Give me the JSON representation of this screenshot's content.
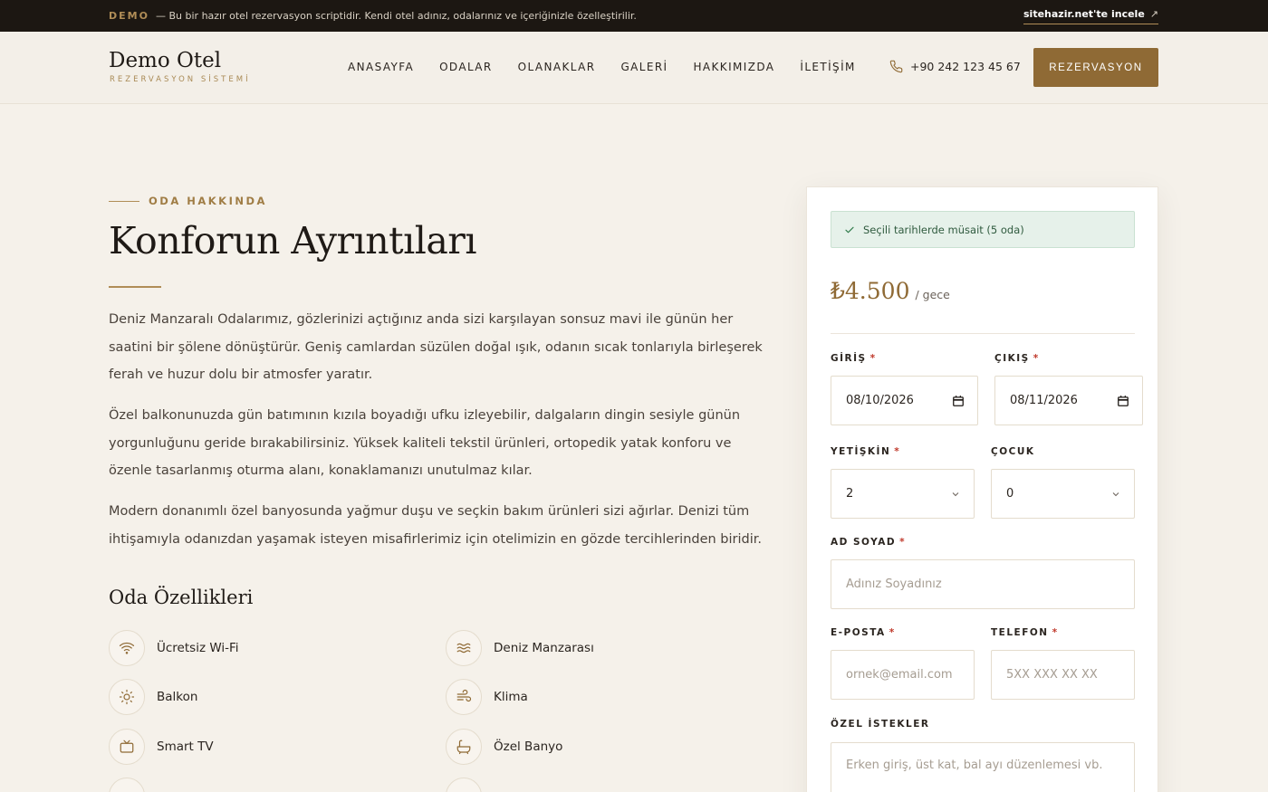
{
  "demo_bar": {
    "tag": "DEMO",
    "message": "— Bu bir hazır otel rezervasyon scriptidir. Kendi otel adınız, odalarınız ve içeriğinizle özelleştirilir.",
    "link_label": "sitehazir.net'te incele",
    "link_arrow": "↗"
  },
  "header": {
    "logo_title": "Demo Otel",
    "logo_subtitle": "REZERVASYON SİSTEMİ",
    "nav": [
      "ANASAYFA",
      "ODALAR",
      "OLANAKLAR",
      "GALERİ",
      "HAKKIMIZDA",
      "İLETİŞİM"
    ],
    "phone": "+90 242 123 45 67",
    "cta_label": "REZERVASYON"
  },
  "about": {
    "eyebrow": "ODA HAKKINDA",
    "title": "Konforun Ayrıntıları",
    "paragraphs": [
      "Deniz Manzaralı Odalarımız, gözlerinizi açtığınız anda sizi karşılayan sonsuz mavi ile günün her saatini bir şölene dönüştürür. Geniş camlardan süzülen doğal ışık, odanın sıcak tonlarıyla birleşerek ferah ve huzur dolu bir atmosfer yaratır.",
      "Özel balkonunuzda gün batımının kızıla boyadığı ufku izleyebilir, dalgaların dingin sesiyle günün yorgunluğunu geride bırakabilirsiniz. Yüksek kaliteli tekstil ürünleri, ortopedik yatak konforu ve özenle tasarlanmış oturma alanı, konaklamanızı unutulmaz kılar.",
      "Modern donanımlı özel banyosunda yağmur duşu ve seçkin bakım ürünleri sizi ağırlar. Denizi tüm ihtişamıyla odanızdan yaşamak isteyen misafirlerimiz için otelimizin en gözde tercihlerinden biridir."
    ],
    "features_title": "Oda Özellikleri",
    "features": [
      {
        "label": "Ücretsiz Wi-Fi",
        "icon": "wifi-icon"
      },
      {
        "label": "Deniz Manzarası",
        "icon": "waves-icon"
      },
      {
        "label": "Balkon",
        "icon": "sun-icon"
      },
      {
        "label": "Klima",
        "icon": "wind-icon"
      },
      {
        "label": "Smart TV",
        "icon": "tv-icon"
      },
      {
        "label": "Özel Banyo",
        "icon": "bath-icon"
      }
    ]
  },
  "booking": {
    "availability": "Seçili tarihlerde müsait (5 oda)",
    "price": "₺4.500",
    "per_night": "/ gece",
    "checkin_label": "GİRİŞ",
    "checkin_value": "08/10/2026",
    "checkout_label": "ÇIKIŞ",
    "checkout_value": "08/11/2026",
    "adults_label": "YETİŞKİN",
    "adults_value": "2",
    "children_label": "ÇOCUK",
    "children_value": "0",
    "name_label": "AD SOYAD",
    "name_placeholder": "Adınız Soyadınız",
    "email_label": "E-POSTA",
    "email_placeholder": "ornek@email.com",
    "phone_label": "TELEFON",
    "phone_placeholder": "5XX XXX XX XX",
    "notes_label": "ÖZEL İSTEKLER",
    "notes_placeholder": "Erken giriş, üst kat, bal ayı düzenlemesi vb.",
    "required_mark": "*"
  },
  "colors": {
    "accent": "#8f6a35",
    "dark_bar": "#1c1712",
    "background": "#f5f1ea",
    "success_bg": "#e6f1ea"
  }
}
